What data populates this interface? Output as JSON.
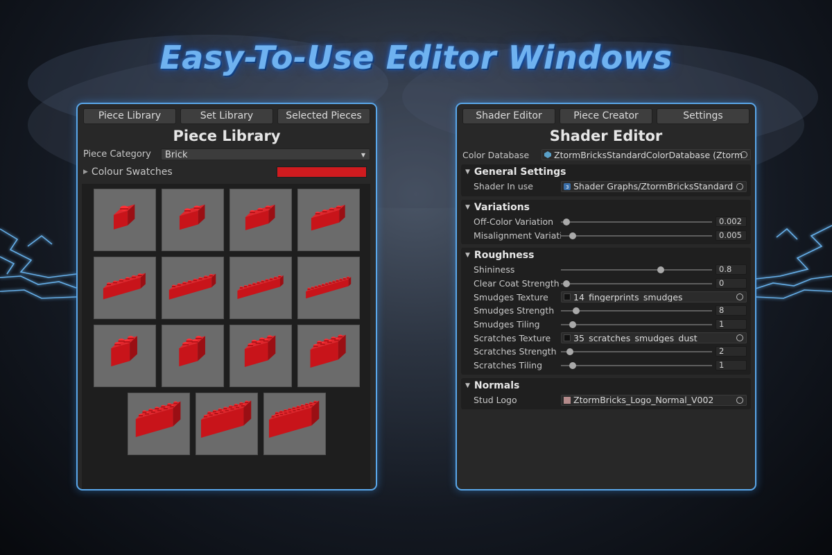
{
  "headline": "Easy-To-Use Editor Windows",
  "left_window": {
    "tabs": [
      "Piece Library",
      "Set Library",
      "Selected Pieces"
    ],
    "title": "Piece Library",
    "category_label": "Piece Category",
    "category_value": "Brick",
    "swatches_label": "Colour Swatches",
    "swatch_color": "#cf1b1f",
    "pieces": [
      {
        "icon": "brick-1x1-icon",
        "studs": 1,
        "depth": 1
      },
      {
        "icon": "brick-1x2-icon",
        "studs": 2,
        "depth": 1
      },
      {
        "icon": "brick-1x3-icon",
        "studs": 3,
        "depth": 1
      },
      {
        "icon": "brick-1x4-icon",
        "studs": 4,
        "depth": 1
      },
      {
        "icon": "brick-1x6-icon",
        "studs": 6,
        "depth": 1
      },
      {
        "icon": "brick-1x8-icon",
        "studs": 8,
        "depth": 1
      },
      {
        "icon": "brick-1x10-icon",
        "studs": 10,
        "depth": 1
      },
      {
        "icon": "brick-1x12-icon",
        "studs": 12,
        "depth": 1
      },
      {
        "icon": "brick-corner-icon",
        "studs": 2,
        "depth": 2
      },
      {
        "icon": "brick-2x2-icon",
        "studs": 2,
        "depth": 2
      },
      {
        "icon": "brick-2x3-icon",
        "studs": 3,
        "depth": 2
      },
      {
        "icon": "brick-2x4-icon",
        "studs": 4,
        "depth": 2
      },
      {
        "icon": "brick-2x6-icon",
        "studs": 6,
        "depth": 2
      },
      {
        "icon": "brick-2x8-icon",
        "studs": 8,
        "depth": 2
      },
      {
        "icon": "brick-2x10-icon",
        "studs": 10,
        "depth": 2
      }
    ]
  },
  "right_window": {
    "tabs": [
      "Shader Editor",
      "Piece Creator",
      "Settings"
    ],
    "title": "Shader Editor",
    "color_database_label": "Color Database",
    "color_database_value": "ZtormBricksStandardColorDatabase (Ztorm",
    "sections": {
      "general": {
        "title": "General Settings",
        "shader_label": "Shader In use",
        "shader_value": "Shader Graphs/ZtormBricksStandard"
      },
      "variations": {
        "title": "Variations",
        "offcolor_label": "Off-Color Variation",
        "offcolor_value": "0.002",
        "offcolor_level": 0.002,
        "misalign_label": "Misalignment Variation",
        "misalign_value": "0.005",
        "misalign_level": 0.05
      },
      "roughness": {
        "title": "Roughness",
        "shininess_label": "Shininess",
        "shininess_value": "0.8",
        "shininess_level": 0.8,
        "clearcoat_label": "Clear Coat Strength",
        "clearcoat_value": "0",
        "clearcoat_level": 0,
        "smudges_tex_label": "Smudges Texture",
        "smudges_tex_value": "14_fingerprints_smudges",
        "smudges_strength_label": "Smudges Strength",
        "smudges_strength_value": "8",
        "smudges_strength_level": 0.08,
        "smudges_tiling_label": "Smudges Tiling",
        "smudges_tiling_value": "1",
        "smudges_tiling_level": 0.05,
        "scratches_tex_label": "Scratches Texture",
        "scratches_tex_value": "35_scratches_smudges_dust",
        "scratches_strength_label": "Scratches Strength",
        "scratches_strength_value": "2",
        "scratches_strength_level": 0.03,
        "scratches_tiling_label": "Scratches Tiling",
        "scratches_tiling_value": "1",
        "scratches_tiling_level": 0.05
      },
      "normals": {
        "title": "Normals",
        "stud_logo_label": "Stud Logo",
        "stud_logo_value": "ZtormBricks_Logo_Normal_V002"
      }
    }
  },
  "colors": {
    "accent_border": "#5aa7ea",
    "brick_red": "#c8141a",
    "window_bg": "#282828"
  }
}
